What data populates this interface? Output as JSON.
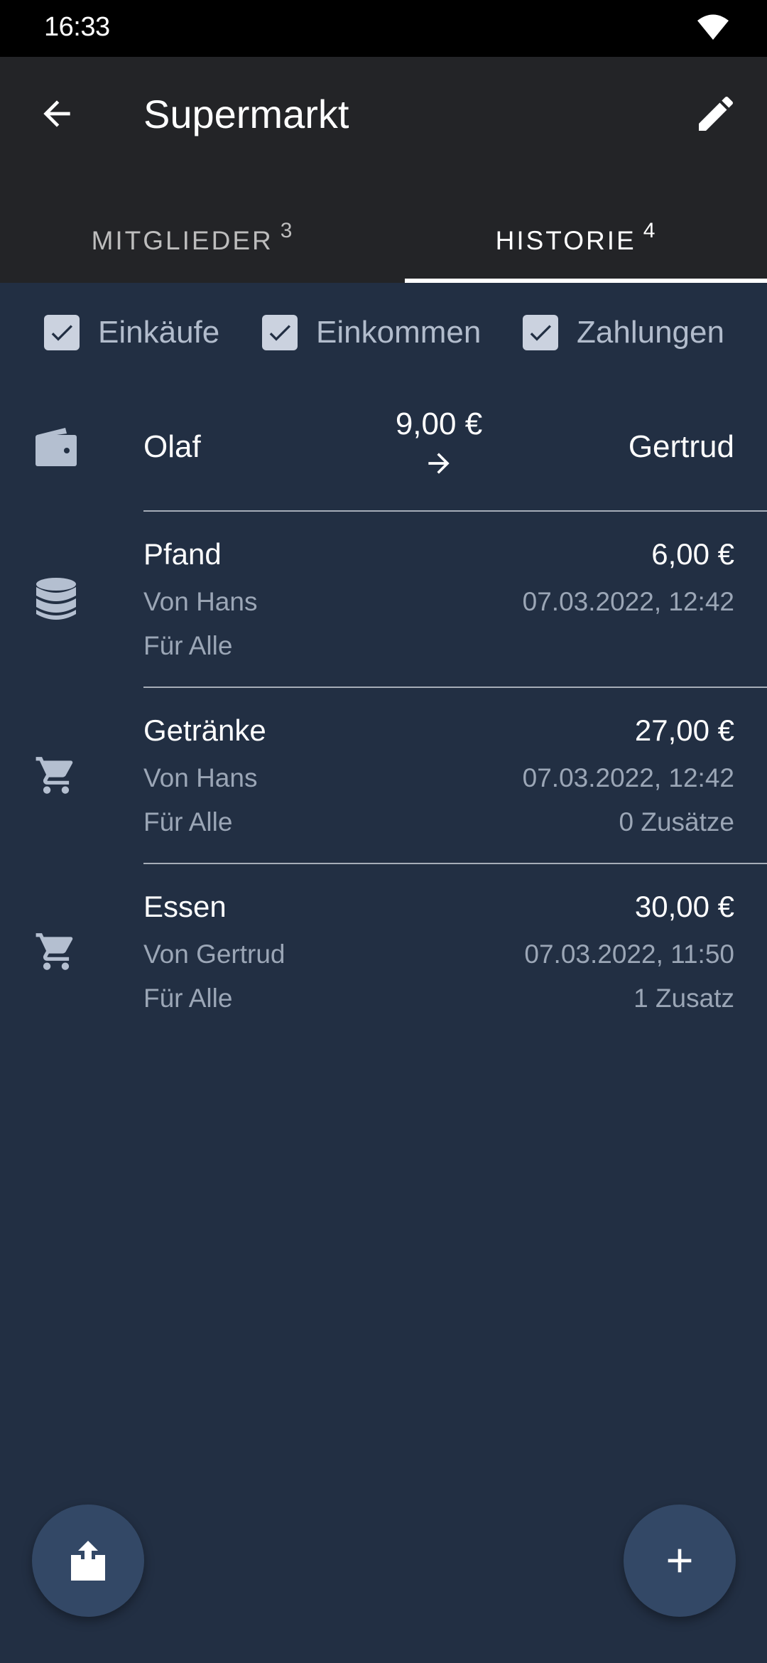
{
  "status_bar": {
    "time": "16:33",
    "wifi_icon": "wifi-icon"
  },
  "app_bar": {
    "title": "Supermarkt",
    "back_icon": "arrow-left-icon",
    "edit_icon": "pencil-icon"
  },
  "tabs": [
    {
      "label": "MITGLIEDER",
      "count": "3",
      "selected": false
    },
    {
      "label": "HISTORIE",
      "count": "4",
      "selected": true
    }
  ],
  "filters": [
    {
      "label": "Einkäufe",
      "checked": true
    },
    {
      "label": "Einkommen",
      "checked": true
    },
    {
      "label": "Zahlungen",
      "checked": true
    }
  ],
  "payment": {
    "icon": "wallet-icon",
    "from": "Olaf",
    "amount": "9,00 €",
    "to": "Gertrud"
  },
  "entries": [
    {
      "icon": "coins-icon",
      "title": "Pfand",
      "by": "Von Hans",
      "for": "Für Alle",
      "amount": "6,00 €",
      "date": "07.03.2022, 12:42",
      "extras": ""
    },
    {
      "icon": "cart-icon",
      "title": "Getränke",
      "by": "Von Hans",
      "for": "Für Alle",
      "amount": "27,00 €",
      "date": "07.03.2022, 12:42",
      "extras": "0 Zusätze"
    },
    {
      "icon": "cart-icon",
      "title": "Essen",
      "by": "Von Gertrud",
      "for": "Für Alle",
      "amount": "30,00 €",
      "date": "07.03.2022, 11:50",
      "extras": "1 Zusatz"
    }
  ],
  "fabs": {
    "share_icon": "share-icon",
    "add_icon": "plus-icon"
  },
  "colors": {
    "background": "#222f43",
    "app_bar": "#232427",
    "fab": "#334866",
    "checkbox": "#cbd2df",
    "secondary_text": "#9ba6b6"
  }
}
